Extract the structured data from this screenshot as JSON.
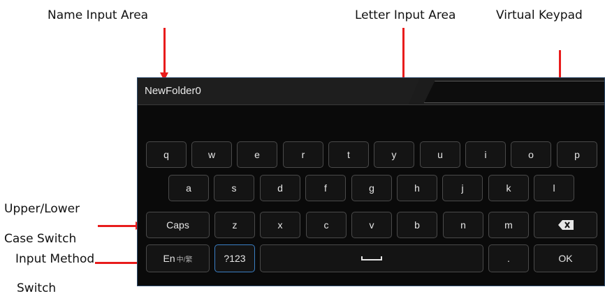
{
  "annotations": {
    "name_input": "Name Input Area",
    "letter_input": "Letter Input Area",
    "keypad": "Virtual Keypad",
    "case_switch_1": "Upper/Lower",
    "case_switch_2": "Case Switch",
    "method_switch_1": "Input Method",
    "method_switch_2": "Switch"
  },
  "name_field": {
    "value": "NewFolder0"
  },
  "keyboard": {
    "row1": [
      "q",
      "w",
      "e",
      "r",
      "t",
      "y",
      "u",
      "i",
      "o",
      "p"
    ],
    "row2": [
      "a",
      "s",
      "d",
      "f",
      "g",
      "h",
      "j",
      "k",
      "l"
    ],
    "row3": {
      "caps": "Caps",
      "letters": [
        "z",
        "x",
        "c",
        "v",
        "b",
        "n",
        "m"
      ],
      "backspace_icon": "backspace-icon"
    },
    "row4": {
      "lang_main": "En",
      "lang_sub": "中/繁",
      "symbols": "?123",
      "space_icon": "space-icon",
      "dot": ".",
      "ok": "OK"
    }
  },
  "colors": {
    "annotation_arrow": "#e81c1c",
    "panel_bg": "#0a0a0a",
    "active_key_border": "#3b7fc4"
  }
}
